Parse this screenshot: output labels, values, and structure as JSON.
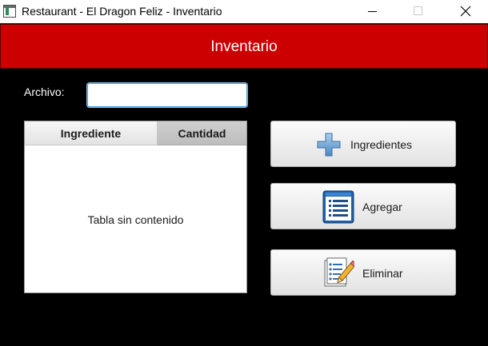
{
  "window": {
    "title": "Restaurant - El Dragon Feliz - Inventario"
  },
  "header": {
    "title": "Inventario",
    "color": "#cc0000"
  },
  "archivo": {
    "label": "Archivo:",
    "value": "",
    "placeholder": ""
  },
  "table": {
    "columns": [
      "Ingrediente",
      "Cantidad"
    ],
    "rows": [],
    "empty_text": "Tabla sin contenido"
  },
  "buttons": {
    "ingredientes": {
      "label": "Ingredientes",
      "icon": "plus-icon"
    },
    "agregar": {
      "label": "Agregar",
      "icon": "list-icon"
    },
    "eliminar": {
      "label": "Eliminar",
      "icon": "edit-checklist-icon"
    }
  }
}
